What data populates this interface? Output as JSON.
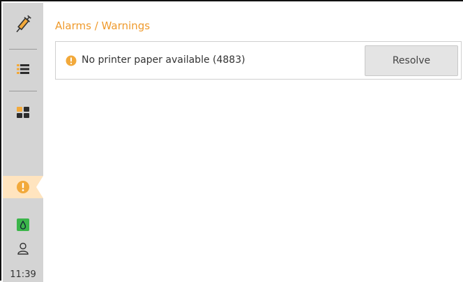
{
  "sidebar": {
    "items": [
      {
        "icon": "syringe-icon"
      },
      {
        "icon": "list-icon"
      },
      {
        "icon": "dashboard-icon"
      },
      {
        "icon": "alarm-icon"
      },
      {
        "icon": "drop-icon"
      },
      {
        "icon": "user-icon"
      }
    ],
    "time": "11:39"
  },
  "main": {
    "title": "Alarms / Warnings",
    "alarms": [
      {
        "message": "No printer paper available (4883)",
        "action_label": "Resolve"
      }
    ]
  },
  "colors": {
    "accent": "#ef9a2c",
    "sidebar_bg": "#d4d4d4",
    "ok_green": "#3bb54a"
  }
}
